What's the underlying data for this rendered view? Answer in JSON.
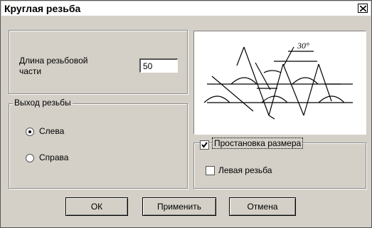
{
  "window": {
    "title": "Круглая резьба"
  },
  "thread_length": {
    "label_line1": "Длина резьбовой",
    "label_line2": "части",
    "value": "50"
  },
  "thread_exit": {
    "group_title": "Выход резьбы",
    "options": [
      {
        "label": "Слева",
        "selected": true
      },
      {
        "label": "Справа",
        "selected": false
      }
    ]
  },
  "preview": {
    "angle_label": "30°"
  },
  "dimension": {
    "dims_label": "Простановка размера",
    "dims_checked": true,
    "left_thread_label": "Левая резьба",
    "left_thread_checked": false
  },
  "buttons": {
    "ok": "ОК",
    "apply": "Применить",
    "cancel": "Отмена"
  }
}
